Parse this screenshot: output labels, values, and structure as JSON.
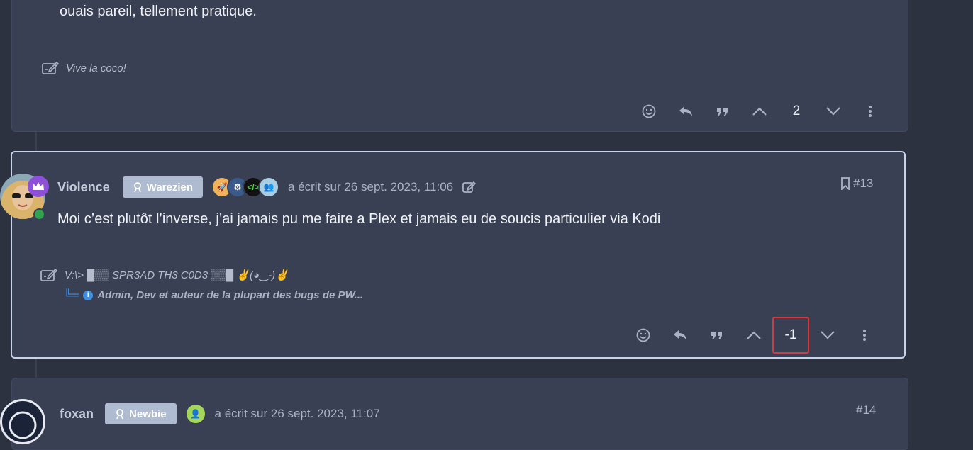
{
  "previous_post": {
    "content": "ouais pareil, tellement pratique.",
    "signature": "Vive la coco!",
    "vote_count": "2"
  },
  "current_post": {
    "username": "Violence",
    "role_badge": "Warezien",
    "meta": "a écrit sur 26 sept. 2023, 11:06",
    "post_number": "#13",
    "content": "Moi c’est plutôt l’inverse, j’ai jamais pu me faire a Plex et jamais eu de soucis particulier via Kodi",
    "signature": "V:\\> █▒▒ SPR3AD TH3 C0D3 ▒▒█ ✌(◕‿-)✌",
    "sub_signature_prefix": "╚═",
    "sub_signature": "Admin, Dev et auteur de la plupart des bugs de PW...",
    "vote_count": "-1",
    "group_badges": [
      "rocket-icon",
      "gears-icon",
      "code-icon",
      "users-icon"
    ]
  },
  "next_post": {
    "username": "foxan",
    "role_badge": "Newbie",
    "meta": "a écrit sur 26 sept. 2023, 11:07",
    "post_number": "#14"
  },
  "colors": {
    "page_bg": "#2d3240",
    "post_bg": "#394053",
    "selected_border": "#c7d3ea",
    "highlight_box": "#d43a3a",
    "online": "#2fa34f"
  }
}
